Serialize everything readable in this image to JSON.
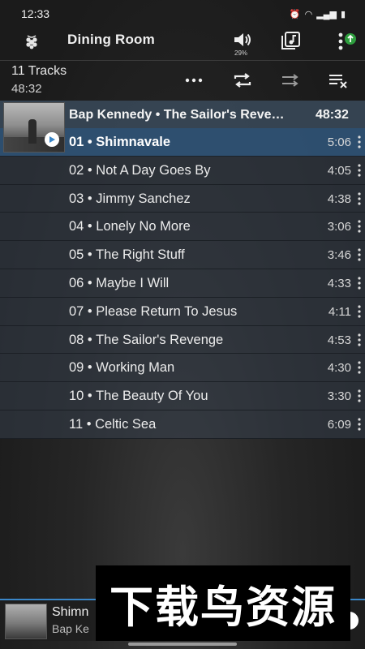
{
  "status_bar": {
    "time": "12:33"
  },
  "app_bar": {
    "title": "Dining Room",
    "volume_percent": "29%"
  },
  "queue": {
    "track_count": "11 Tracks",
    "total_time": "48:32"
  },
  "album": {
    "title": "Bap Kennedy • The Sailor's Reve…",
    "duration": "48:32"
  },
  "tracks": [
    {
      "label": "01 • Shimnavale",
      "duration": "5:06"
    },
    {
      "label": "02 • Not A Day Goes By",
      "duration": "4:05"
    },
    {
      "label": "03 • Jimmy Sanchez",
      "duration": "4:38"
    },
    {
      "label": "04 • Lonely No More",
      "duration": "3:06"
    },
    {
      "label": "05 • The Right Stuff",
      "duration": "3:46"
    },
    {
      "label": "06 • Maybe I Will",
      "duration": "4:33"
    },
    {
      "label": "07 • Please Return To Jesus",
      "duration": "4:11"
    },
    {
      "label": "08 • The Sailor's Revenge",
      "duration": "4:53"
    },
    {
      "label": "09 • Working Man",
      "duration": "4:30"
    },
    {
      "label": "10 • The Beauty Of You",
      "duration": "3:30"
    },
    {
      "label": "11 • Celtic Sea",
      "duration": "6:09"
    }
  ],
  "mini_player": {
    "track": "Shimn",
    "artist": "Bap Ke"
  },
  "watermark": {
    "text": "下载鸟资源"
  },
  "colors": {
    "accent": "#3a86c8",
    "current_row": "#305478",
    "header_row": "#3a4a5a"
  }
}
